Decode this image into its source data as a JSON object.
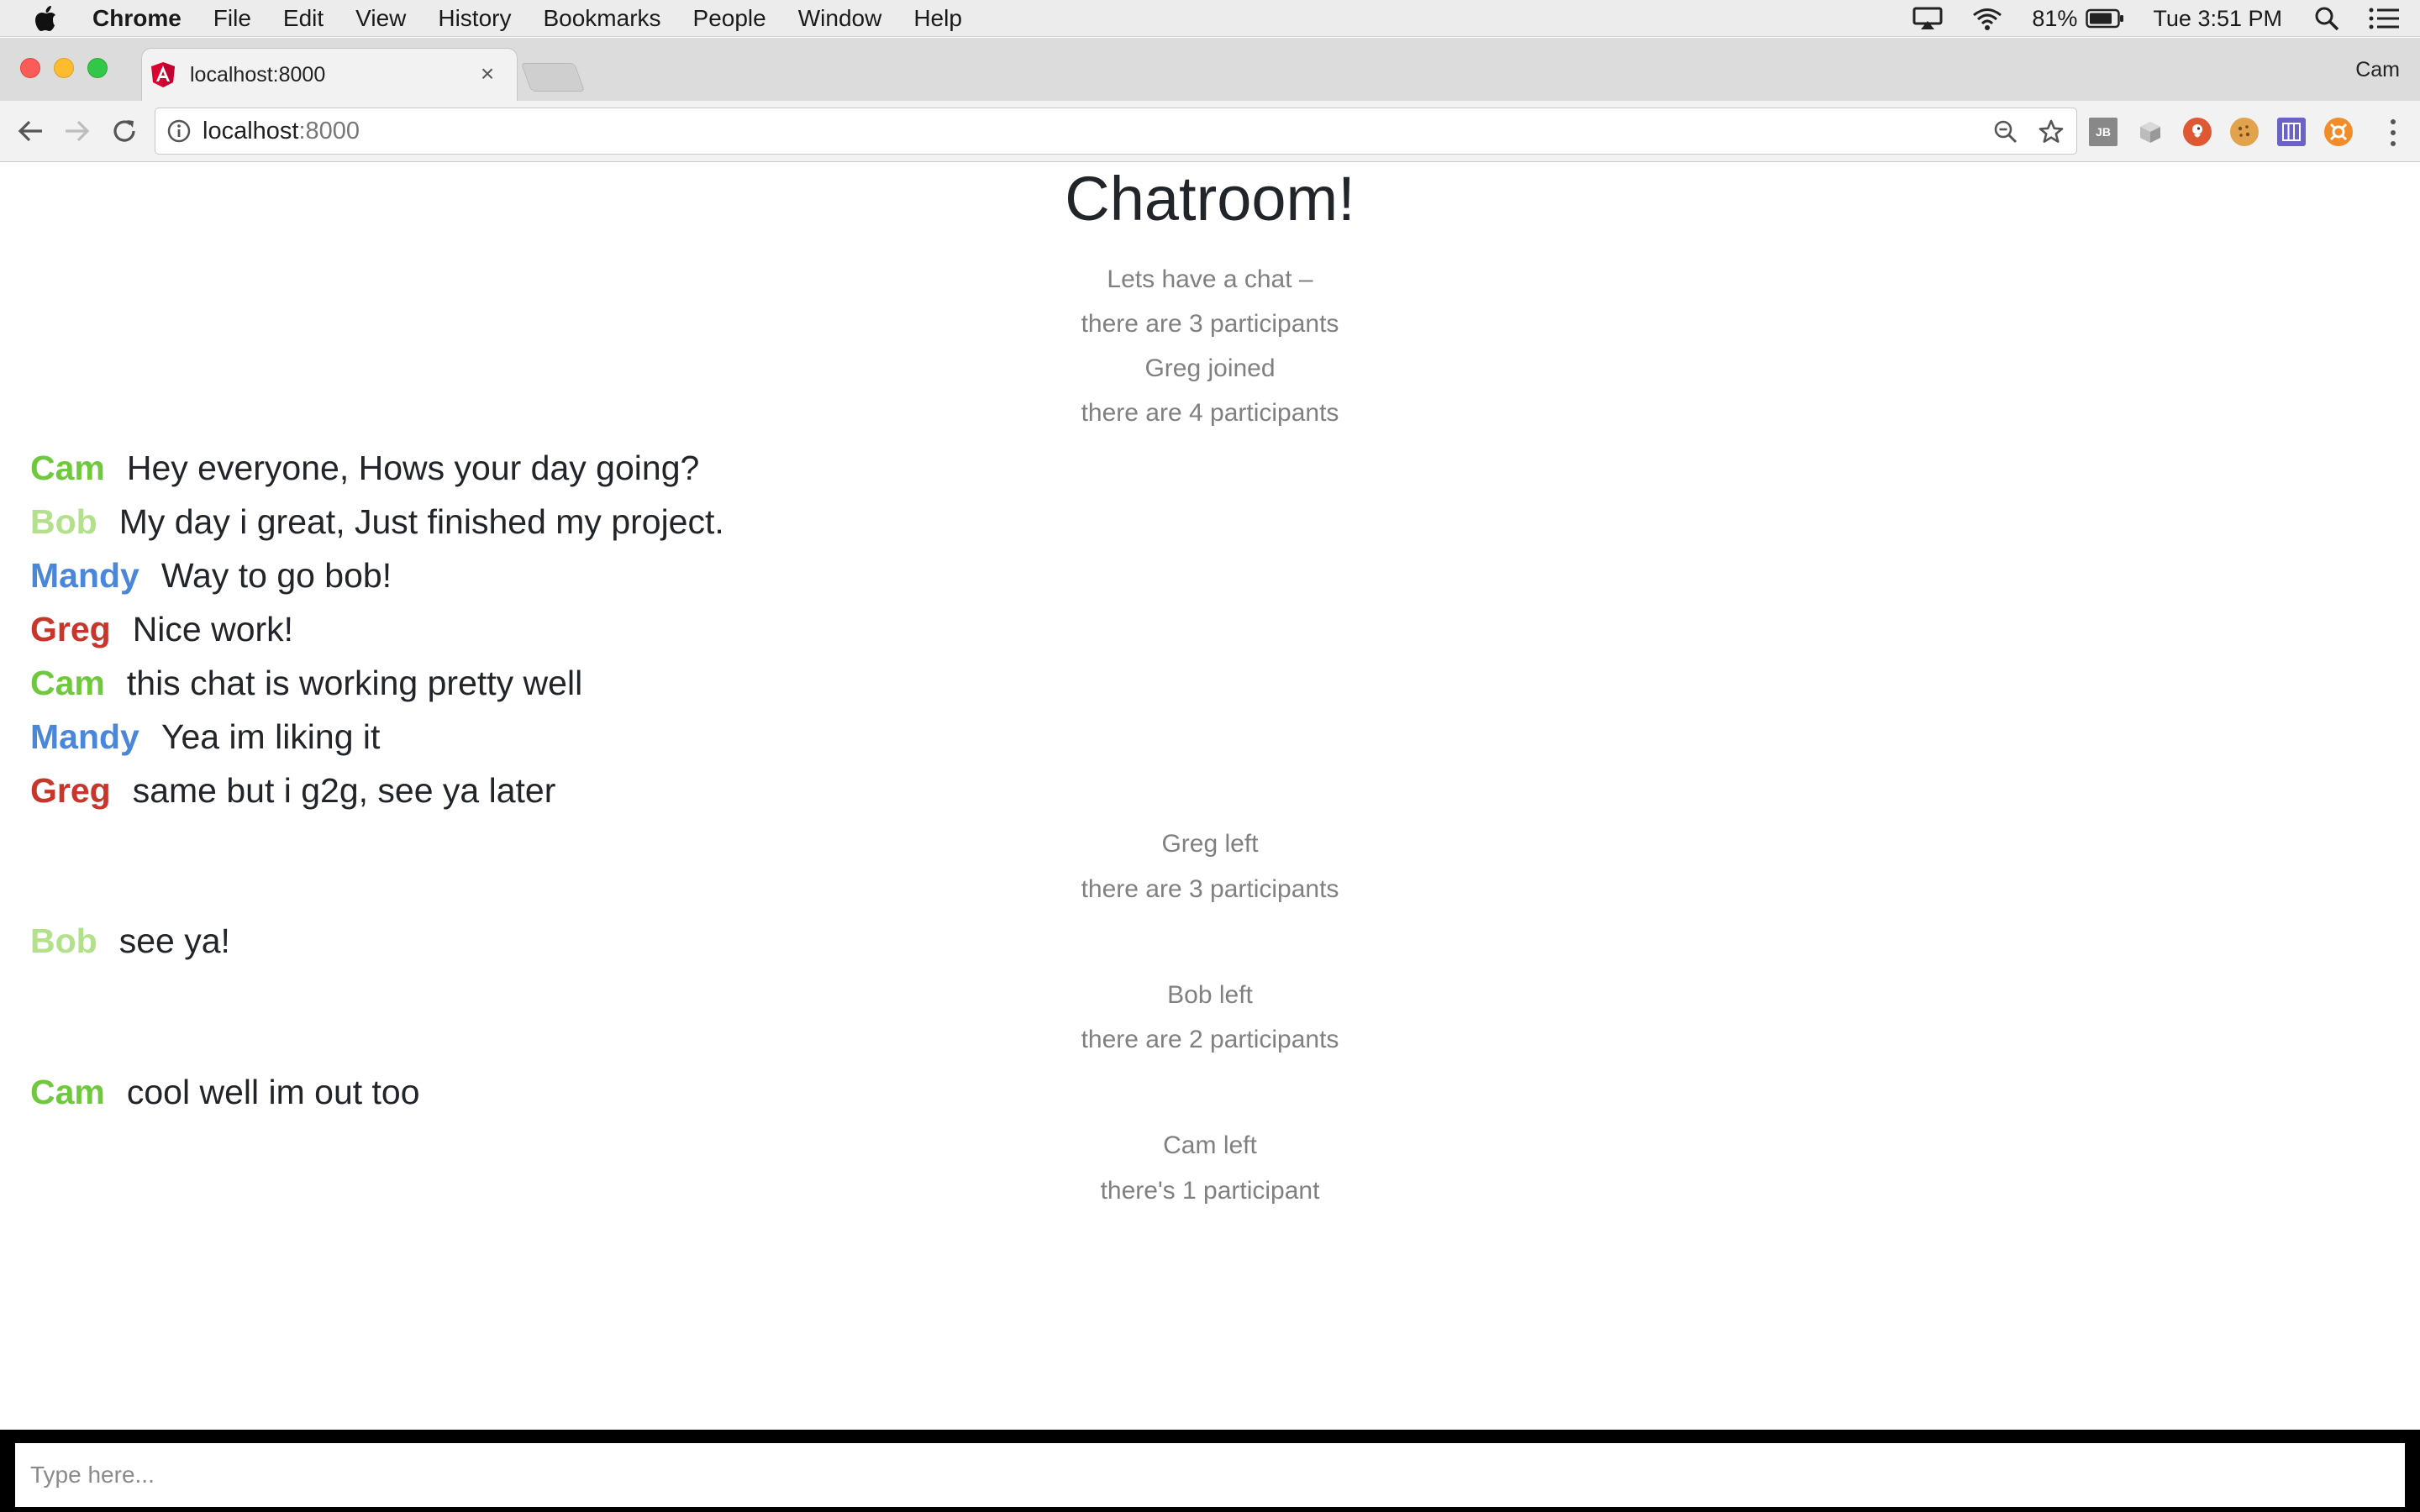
{
  "menubar": {
    "app_name": "Chrome",
    "items": [
      "File",
      "Edit",
      "View",
      "History",
      "Bookmarks",
      "People",
      "Window",
      "Help"
    ],
    "battery_percent": "81%",
    "clock": "Tue 3:51 PM"
  },
  "browser": {
    "tab_title": "localhost:8000",
    "tab_close": "×",
    "profile_name": "Cam",
    "url_host": "localhost",
    "url_port": ":8000"
  },
  "chat": {
    "title": "Chatroom!",
    "input_placeholder": "Type here...",
    "colors": {
      "Cam": "#6fc93c",
      "Bob": "#b3e08a",
      "Mandy": "#4a86d9",
      "Greg": "#c8352b"
    },
    "system_messages": [
      "Lets have a chat –",
      "there are 3 participants",
      "Greg joined",
      "there are 4 participants",
      "Greg left",
      "there are 3 participants",
      "Bob left",
      "there are 2 participants",
      "Cam left",
      "there's 1 participant"
    ],
    "messages": [
      {
        "name": "Cam",
        "text": "Hey everyone, Hows your day going?"
      },
      {
        "name": "Bob",
        "text": "My day i great, Just finished my project."
      },
      {
        "name": "Mandy",
        "text": "Way to go bob!"
      },
      {
        "name": "Greg",
        "text": "Nice work!"
      },
      {
        "name": "Cam",
        "text": "this chat is working pretty well"
      },
      {
        "name": "Mandy",
        "text": "Yea im liking it"
      },
      {
        "name": "Greg",
        "text": "same but i g2g, see ya later"
      },
      {
        "name": "Bob",
        "text": "see ya!"
      },
      {
        "name": "Cam",
        "text": "cool well im out too"
      }
    ]
  }
}
